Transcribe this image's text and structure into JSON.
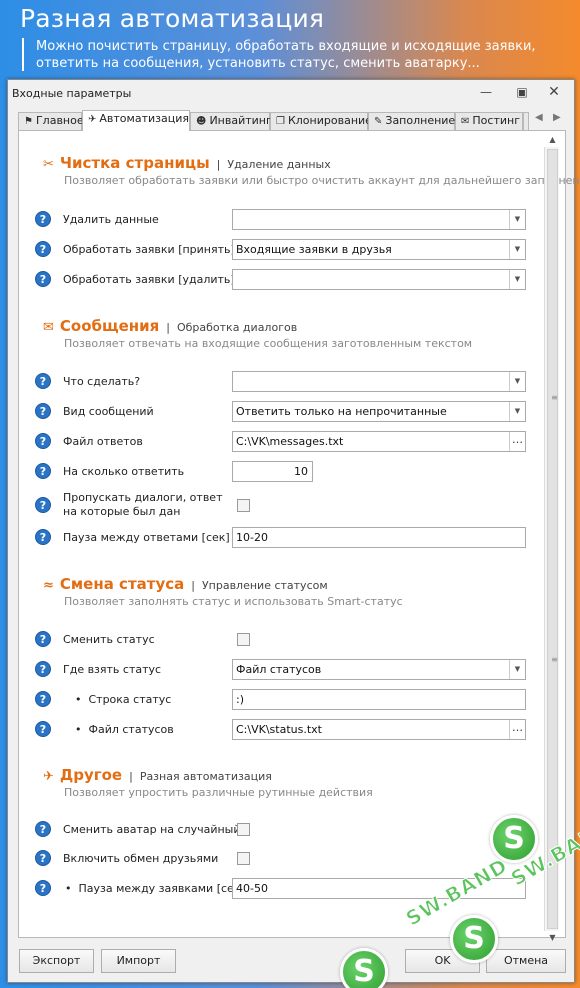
{
  "banner": {
    "title": "Разная автоматизация",
    "line1": "Можно почистить страницу, обработать входящие и исходящие заявки,",
    "line2": "ответить на сообщения, установить статус, сменить аватарку..."
  },
  "window": {
    "title": "Входные параметры"
  },
  "tabs": [
    {
      "label": "Главное",
      "icon": "flag-icon"
    },
    {
      "label": "Автоматизация",
      "icon": "plane-icon"
    },
    {
      "label": "Инвайтинг",
      "icon": "users-icon"
    },
    {
      "label": "Клонирование",
      "icon": "clone-icon"
    },
    {
      "label": "Заполнение",
      "icon": "pencil-icon"
    },
    {
      "label": "Постинг",
      "icon": "envelope-icon"
    }
  ],
  "sections": {
    "clean": {
      "title": "Чистка страницы",
      "subtitle": "Удаление данных",
      "desc": "Позволяет обработать заявки или быстро очистить аккаунт для дальнейшего заполнения"
    },
    "messages": {
      "title": "Сообщения",
      "subtitle": "Обработка диалогов",
      "desc": "Позволяет отвечать на входящие сообщения заготовленным текстом"
    },
    "status": {
      "title": "Смена статуса",
      "subtitle": "Управление статусом",
      "desc": "Позволяет заполнять статус и использовать Smart-статус"
    },
    "other": {
      "title": "Другое",
      "subtitle": "Разная автоматизация",
      "desc": "Позволяет упростить различные рутинные действия"
    }
  },
  "fields": {
    "delete_data": {
      "label": "Удалить данные",
      "value": ""
    },
    "accept_requests": {
      "label": "Обработать заявки [принять]",
      "value": "Входящие заявки в друзья"
    },
    "delete_requests": {
      "label": "Обработать заявки [удалить]",
      "value": ""
    },
    "what_to_do": {
      "label": "Что сделать?",
      "value": ""
    },
    "msg_type": {
      "label": "Вид сообщений",
      "value": "Ответить только на непрочитанные"
    },
    "answers_file": {
      "label": "Файл ответов",
      "value": "C:\\VK\\messages.txt"
    },
    "reply_count": {
      "label": "На сколько ответить",
      "value": "10"
    },
    "skip_dialogs": {
      "label": "Пропускать диалоги, ответ на которые был дан",
      "checked": false
    },
    "reply_pause": {
      "label": "Пауза между ответами [сек]",
      "value": "10-20"
    },
    "change_status": {
      "label": "Сменить статус",
      "checked": false
    },
    "status_source": {
      "label": "Где взять статус",
      "value": "Файл статусов"
    },
    "status_line": {
      "label": "Строка статус",
      "value": ":)"
    },
    "status_file": {
      "label": "Файл статусов",
      "value": "C:\\VK\\status.txt"
    },
    "random_avatar": {
      "label": "Сменить аватар на случайный",
      "checked": false
    },
    "friend_exchange": {
      "label": "Включить обмен друзьями",
      "checked": false
    },
    "request_pause": {
      "label": "Пауза между заявками [сек]",
      "value": "40-50"
    }
  },
  "buttons": {
    "export": "Экспорт",
    "import": "Импорт",
    "ok": "OK",
    "cancel": "Отмена"
  },
  "watermark": {
    "text": "SW.BAND"
  },
  "colors": {
    "accent": "#e36d12",
    "help": "#2a74c5"
  }
}
